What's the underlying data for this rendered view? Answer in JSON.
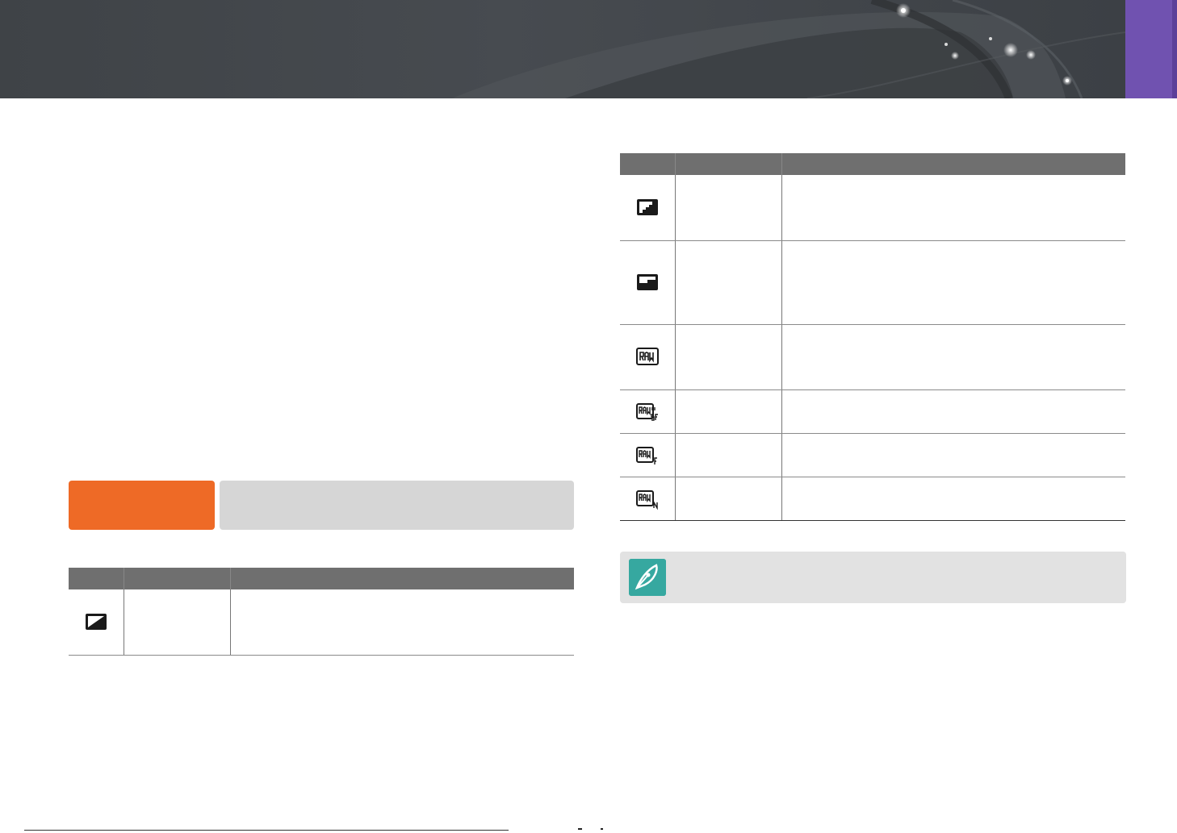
{
  "colors": {
    "banner": "#45494e",
    "side_tab": "#7052b0",
    "option_label": "#ee6a26",
    "option_bar": "#d6d6d6",
    "table_header": "#6f6f6f",
    "note_background": "#e2e2e2",
    "note_icon": "#36a8a0"
  },
  "icons": {
    "left_table": [
      "picture-style-standard-icon"
    ],
    "right_table": [
      "picture-style-high-icon",
      "picture-style-low-icon",
      "raw-icon",
      "raw-superfine-icon",
      "raw-fine-icon",
      "raw-normal-icon"
    ],
    "note": "pen-nib-icon"
  }
}
